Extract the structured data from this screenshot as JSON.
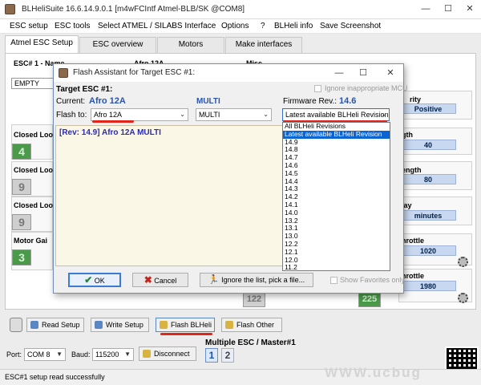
{
  "app": {
    "title": "BLHeliSuite 16.6.14.9.0.1  [m4wFCIntf Atmel-BLB/SK @COM8]",
    "win_minimize": "—",
    "win_maximize": "☐",
    "win_close": "✕"
  },
  "menu": [
    "ESC setup",
    "ESC tools",
    "Select ATMEL / SILABS Interface",
    "Options",
    "?",
    "BLHeli info",
    "Save Screenshot"
  ],
  "tabs": [
    "Atmel ESC Setup",
    "ESC overview",
    "Motors",
    "Make interfaces"
  ],
  "background": {
    "esc_label": "ESC# 1 - Name",
    "esc_name": "Afro 12A",
    "misc_label": "Misc",
    "empty_field": "EMPTY",
    "closed_loop_1": "Closed Loo",
    "closed_loop_2": "Closed Loo",
    "closed_loop_3": "Closed Loo",
    "motor_gain": "Motor Gai",
    "num_1": "4",
    "num_2": "9",
    "num_3": "9",
    "num_4": "3",
    "polarity_label": "rity",
    "polarity_value": "Positive",
    "length_label": "gth",
    "length_value": "40",
    "strength_label": "ength",
    "strength_value": "80",
    "delay_label": "lay",
    "delay_value": "minutes",
    "throttle1_label": "hrottle",
    "throttle1_value": "1020",
    "throttle2_label": "hrottle",
    "throttle2_value": "1980",
    "bottom_num_1": "122",
    "bottom_num_2": "225"
  },
  "toolbar": {
    "read_setup": "Read Setup",
    "write_setup": "Write Setup",
    "flash_blheli": "Flash BLHeli",
    "flash_other": "Flash Other"
  },
  "port": {
    "port_label": "Port:",
    "port_value": "COM 8",
    "baud_label": "Baud:",
    "baud_value": "115200",
    "disconnect": "Disconnect",
    "multiple_esc": "Multiple ESC / Master#1",
    "esc1": "1",
    "esc2": "2"
  },
  "status": "ESC#1 setup read successfully",
  "watermark": "WWW.ucbug",
  "dialog": {
    "title": "Flash Assistant for Target ESC #1:",
    "win_minimize": "—",
    "win_maximize": "☐",
    "win_close": "✕",
    "target_label": "Target ESC #1:",
    "ignore_mcu": "Ignore inappropriate MCU",
    "current_label": "Current:",
    "current_value": "Afro 12A",
    "multi_label": "MULTI",
    "firmware_label": "Firmware Rev.:",
    "firmware_value": "14.6",
    "flash_to_label": "Flash to:",
    "flash_to_value": "Afro 12A",
    "multi_value": "MULTI",
    "revision_select": "Latest available BLHeli Revision",
    "output_line": "[Rev: 14.9] Afro 12A MULTI",
    "revisions": [
      "All BLHeli Revisions",
      "Latest available BLHeli Revision",
      "14.9",
      "14.8",
      "14.7",
      "14.6",
      "14.5",
      "14.4",
      "14.3",
      "14.2",
      "14.1",
      "14.0",
      "13.2",
      "13.1",
      "13.0",
      "12.2",
      "12.1",
      "12.0",
      "11.2"
    ],
    "ok": "OK",
    "cancel": "Cancel",
    "ignore_list": "Ignore the list, pick a file...",
    "show_favorites": "Show Favorites only"
  }
}
